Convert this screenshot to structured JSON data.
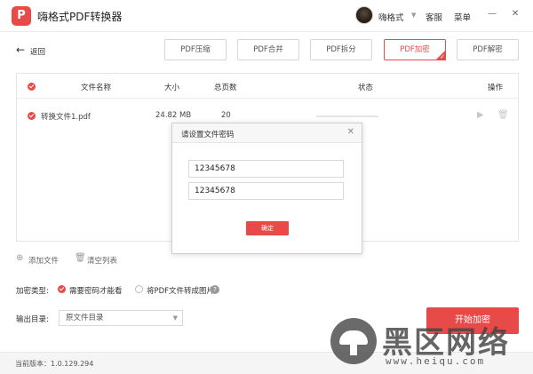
{
  "app": {
    "title": "嗨格式PDF转换器",
    "logo_letter": "P"
  },
  "titlebar": {
    "user_name": "嗨格式",
    "support": "客服",
    "menu": "菜单",
    "minimize": "—",
    "close": "✕"
  },
  "nav": {
    "back_label": "返回",
    "tabs": [
      {
        "label": "PDF压缩"
      },
      {
        "label": "PDF合并"
      },
      {
        "label": "PDF拆分"
      },
      {
        "label": "PDF加密",
        "active": true
      },
      {
        "label": "PDF解密"
      }
    ]
  },
  "table": {
    "headers": {
      "name": "文件名称",
      "size": "大小",
      "pages": "总页数",
      "status": "状态",
      "actions": "操作"
    },
    "rows": [
      {
        "name": "转换文件1.pdf",
        "size": "24.82 MB",
        "pages": "20"
      }
    ]
  },
  "dialog": {
    "title": "请设置文件密码",
    "password1": "12345678",
    "password2": "12345678",
    "confirm_label": "确定"
  },
  "file_actions": {
    "add": "添加文件",
    "clear": "清空列表"
  },
  "options": {
    "encrypt_type_label": "加密类型:",
    "option1": "需要密码才能看",
    "option2": "将PDF文件转成图片",
    "output_label": "输出目录:",
    "output_value": "原文件目录",
    "start_button": "开始加密"
  },
  "status": {
    "version": "当前版本：1.0.129.294"
  },
  "watermark": {
    "text": "黑区网络",
    "url": "www.heiqu.com"
  },
  "colors": {
    "accent": "#e84a4a"
  }
}
